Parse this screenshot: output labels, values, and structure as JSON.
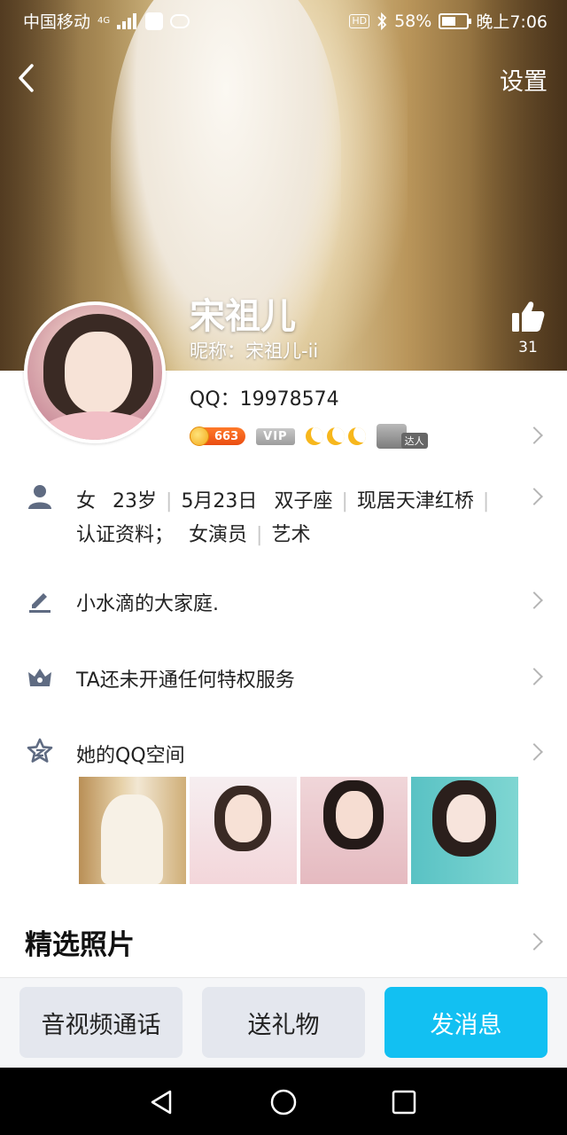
{
  "status_bar": {
    "carrier": "中国移动",
    "network": "4G",
    "hd": "HD",
    "battery_percent": "58%",
    "battery_level": 0.58,
    "time": "晚上7:06"
  },
  "nav": {
    "settings_label": "设置"
  },
  "profile": {
    "name": "宋祖儿",
    "nickname": "昵称：宋祖儿-ii",
    "likes": "31",
    "qq": "QQ：19978574",
    "level": "663",
    "vip_label": "VIP",
    "daren_label": "达人"
  },
  "info": {
    "basics": [
      "女",
      "23岁",
      "5月23日",
      "双子座",
      "现居天津红桥"
    ],
    "cert_label": "认证资料；",
    "cert_values": [
      "女演员",
      "艺术"
    ],
    "signature": "小水滴的大家庭.",
    "privilege": "TA还未开通任何特权服务",
    "qzone": "她的QQ空间"
  },
  "sections": {
    "featured_photos": "精选照片"
  },
  "actions": {
    "call": "音视频通话",
    "gift": "送礼物",
    "message": "发消息"
  },
  "colors": {
    "accent": "#12c0f2",
    "level_badge": "#ea4d12",
    "moon": "#f7b71c"
  }
}
